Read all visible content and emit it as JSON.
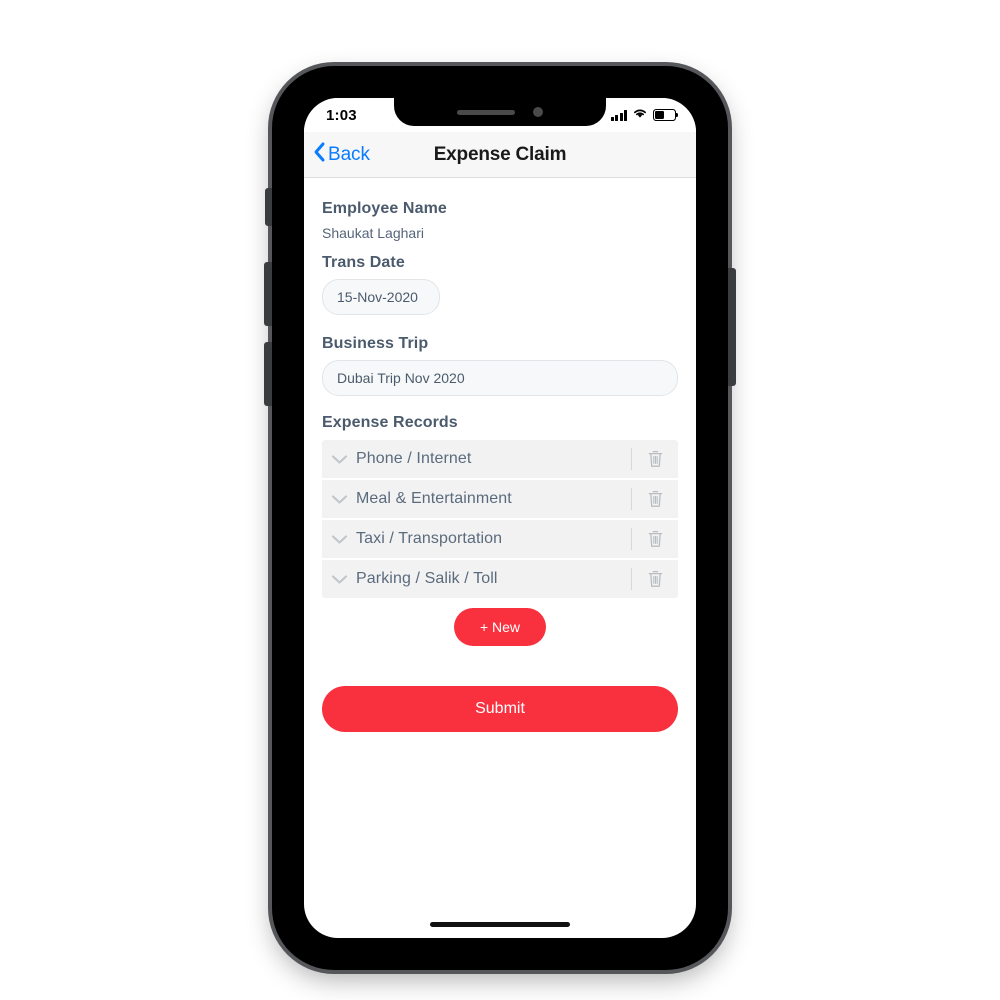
{
  "status_bar": {
    "time": "1:03",
    "signal_icon": "cellular-signal-icon",
    "wifi_icon": "wifi-icon",
    "battery_icon": "battery-icon",
    "battery_level_percent": 45
  },
  "nav_bar": {
    "back_label": "Back",
    "back_icon": "chevron-left-icon",
    "title": "Expense Claim",
    "accent_color": "#0a7cff"
  },
  "form": {
    "employee": {
      "label": "Employee Name",
      "value": "Shaukat Laghari"
    },
    "trans_date": {
      "label": "Trans Date",
      "value": "15-Nov-2020",
      "placeholder": "Trans Date"
    },
    "business_trip": {
      "label": "Business Trip",
      "value": "Dubai Trip Nov 2020",
      "placeholder": "Business Trip"
    }
  },
  "expense_records": {
    "label": "Expense Records",
    "expand_icon": "chevron-down-icon",
    "delete_icon": "trash-icon",
    "rows": [
      {
        "label": "Phone / Internet"
      },
      {
        "label": "Meal & Entertainment"
      },
      {
        "label": "Taxi / Transportation"
      },
      {
        "label": "Parking / Salik / Toll"
      }
    ]
  },
  "actions": {
    "new_label": "+ New",
    "submit_label": "Submit",
    "primary_color": "#f9313f"
  }
}
